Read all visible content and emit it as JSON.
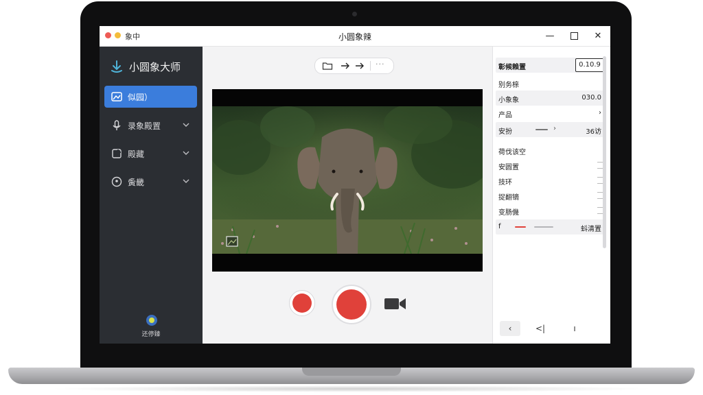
{
  "window": {
    "app_short": "象中",
    "title": "小圆象辣"
  },
  "sidebar": {
    "brand": "小圆象大师",
    "items": [
      {
        "label": "似园）",
        "icon": "image-icon",
        "active": true
      },
      {
        "label": "录象殿置",
        "icon": "microphone-icon",
        "active": false
      },
      {
        "label": "殿藏",
        "icon": "crop-icon",
        "active": false
      },
      {
        "label": "夤畿",
        "icon": "palette-icon",
        "active": false
      }
    ],
    "footer_label": "还停臻"
  },
  "toolbar": {
    "icons": [
      "folder-icon",
      "arrow-right-icon",
      "arrow-right-icon"
    ],
    "more": "···"
  },
  "panel": {
    "header_label": "彰候賴置",
    "version": "0.10.9",
    "section1": "别务榇",
    "rows": [
      {
        "label": "小象象",
        "value": "030.0"
      },
      {
        "label": "产品",
        "value": "›"
      },
      {
        "label": "安扮",
        "value": "36访"
      }
    ],
    "section2": "荷伐该空",
    "list": [
      {
        "label": "安圆置"
      },
      {
        "label": "技环"
      },
      {
        "label": "捉翻镝"
      },
      {
        "label": "变肠僟"
      }
    ],
    "bottom_row": {
      "label": "f",
      "value": "蚪清置"
    },
    "nav": [
      "‹",
      "<|",
      "ı"
    ]
  },
  "colors": {
    "accent": "#3b7ddc",
    "record": "#e0413a",
    "sidebar_bg": "#2b2e33"
  }
}
